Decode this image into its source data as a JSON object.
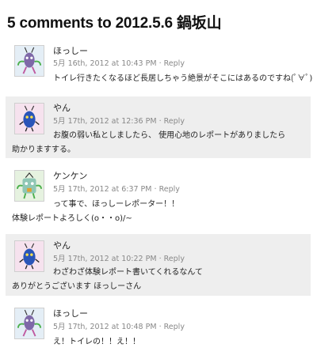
{
  "title": "5 comments to 2012.5.6 鍋坂山",
  "comments": [
    {
      "author": "ほっしー",
      "date": "5月 16th, 2012 at 10:43 PM",
      "separator": "·",
      "reply": "Reply",
      "lines": [
        "トイレ行きたくなるほど長居しちゃう絶景がそこにはあるのですね(ﾟ∀ﾟ)"
      ],
      "avatar": "purple-bug-avatar-icon"
    },
    {
      "author": "やん",
      "date": "5月 17th, 2012 at 12:36 PM",
      "separator": "·",
      "reply": "Reply",
      "lines": [
        "お腹の弱い私としましたら、 使用心地のレポートがありましたら",
        "助かりますする。"
      ],
      "avatar": "blue-bug-avatar-icon"
    },
    {
      "author": "ケンケン",
      "date": "5月 17th, 2012 at 6:37 PM",
      "separator": "·",
      "reply": "Reply",
      "lines": [
        "って事で、ほっしーレポーター！！",
        "体験レポートよろしく(o・・o)/~"
      ],
      "avatar": "green-monster-avatar-icon"
    },
    {
      "author": "やん",
      "date": "5月 17th, 2012 at 10:22 PM",
      "separator": "·",
      "reply": "Reply",
      "lines": [
        "わざわざ体験レポート書いてくれるなんて",
        "ありがとうございます ほっしーさん"
      ],
      "avatar": "blue-bug-avatar-icon"
    },
    {
      "author": "ほっしー",
      "date": "5月 17th, 2012 at 10:48 PM",
      "separator": "·",
      "reply": "Reply",
      "lines": [
        "え！トイレの！！え！！"
      ],
      "avatar": "purple-bug-avatar-icon"
    }
  ]
}
